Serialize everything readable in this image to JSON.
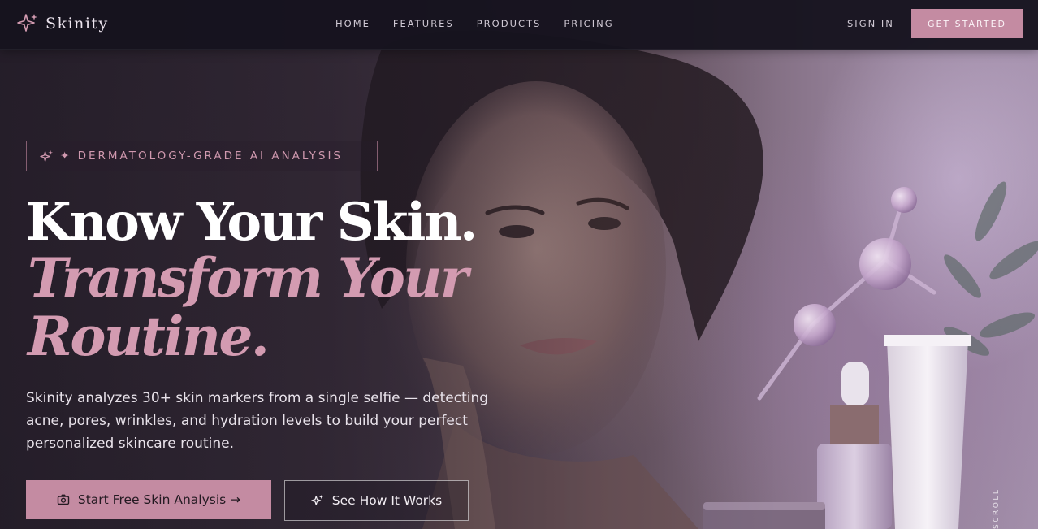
{
  "brand": {
    "name": "Skinity",
    "icon": "sparkle-icon"
  },
  "nav": {
    "links": [
      {
        "label": "HOME"
      },
      {
        "label": "FEATURES"
      },
      {
        "label": "PRODUCTS"
      },
      {
        "label": "PRICING"
      }
    ],
    "sign_in": "SIGN IN",
    "get_started": "GET STARTED"
  },
  "hero": {
    "badge": "✦ DERMATOLOGY-GRADE AI ANALYSIS",
    "badge_icon": "sparkles-icon",
    "headline_line1": "Know Your Skin.",
    "headline_line2": "Transform Your Routine.",
    "description": "Skinity analyzes 30+ skin markers from a single selfie — detecting acne, pores, wrinkles, and hydration levels to build your perfect personalized skincare routine.",
    "primary_cta": "Start Free Skin Analysis →",
    "primary_cta_icon": "camera-icon",
    "secondary_cta": "See How It Works",
    "secondary_cta_icon": "sparkles-icon",
    "scroll_hint": "SCROLL"
  },
  "colors": {
    "accent": "#c48ba2",
    "accent_text": "#d39bb1",
    "nav_background": "#16131e"
  }
}
